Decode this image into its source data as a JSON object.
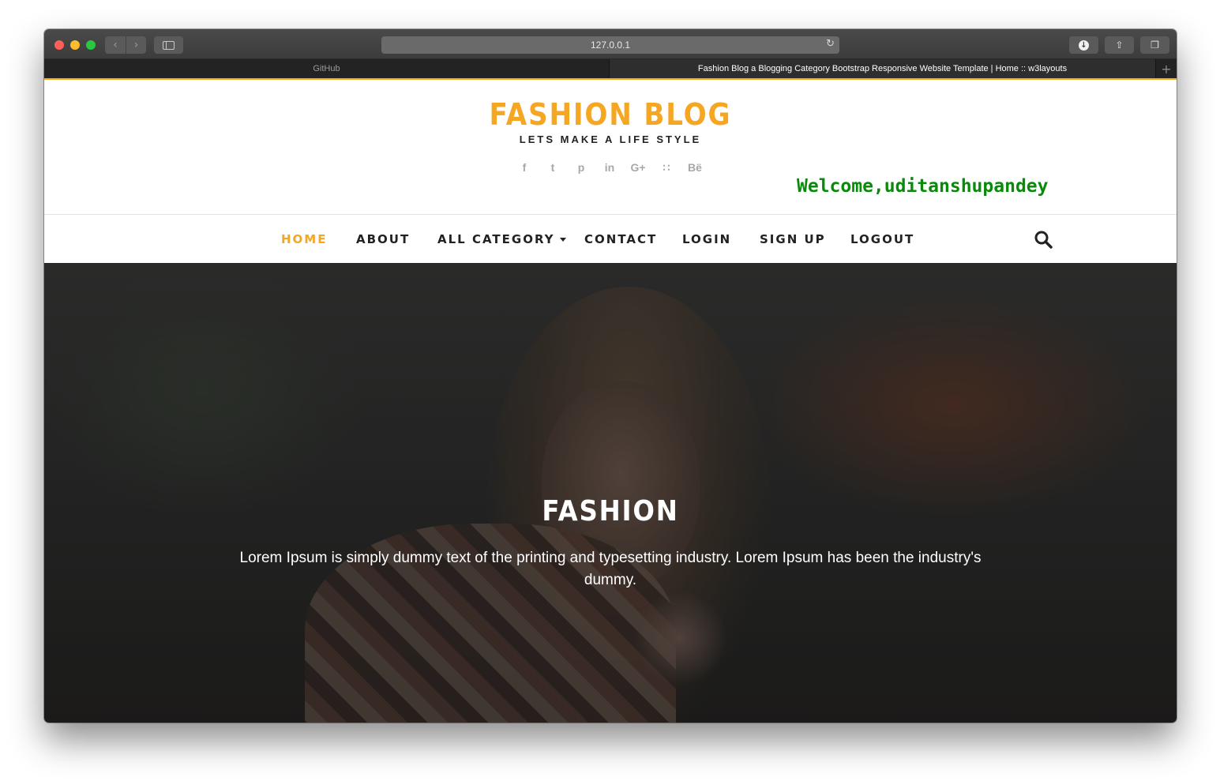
{
  "browser": {
    "url": "127.0.0.1",
    "tabs": [
      {
        "title": "GitHub",
        "active": false
      },
      {
        "title": "Fashion Blog a Blogging Category Bootstrap Responsive Website Template | Home :: w3layouts",
        "active": true
      }
    ],
    "new_tab_label": "+",
    "accent_color": "#f5a623"
  },
  "header": {
    "brand": "FASHION BLOG",
    "tagline": "LETS MAKE A LIFE STYLE",
    "social_icons": [
      {
        "name": "facebook-icon",
        "glyph": "f"
      },
      {
        "name": "twitter-icon",
        "glyph": "t"
      },
      {
        "name": "pinterest-icon",
        "glyph": "p"
      },
      {
        "name": "linkedin-icon",
        "glyph": "in"
      },
      {
        "name": "google-plus-icon",
        "glyph": "G+"
      },
      {
        "name": "rss-icon",
        "glyph": "∷"
      },
      {
        "name": "behance-icon",
        "glyph": "Bë"
      }
    ],
    "welcome": "Welcome,uditanshupandey",
    "welcome_color": "#0a8a0a"
  },
  "nav": {
    "items": [
      {
        "label": "HOME",
        "active": true
      },
      {
        "label": "ABOUT",
        "active": false
      },
      {
        "label": "ALL CATEGORY",
        "active": false,
        "dropdown": true
      },
      {
        "label": "CONTACT",
        "active": false
      },
      {
        "label": "LOGIN",
        "active": false
      },
      {
        "label": "SIGN UP",
        "active": false
      },
      {
        "label": "LOGOUT",
        "active": false
      }
    ],
    "active_color": "#f5a623"
  },
  "hero": {
    "title": "FASHION",
    "text": "Lorem Ipsum is simply dummy text of the printing and typesetting industry. Lorem Ipsum has been the industry's dummy."
  }
}
